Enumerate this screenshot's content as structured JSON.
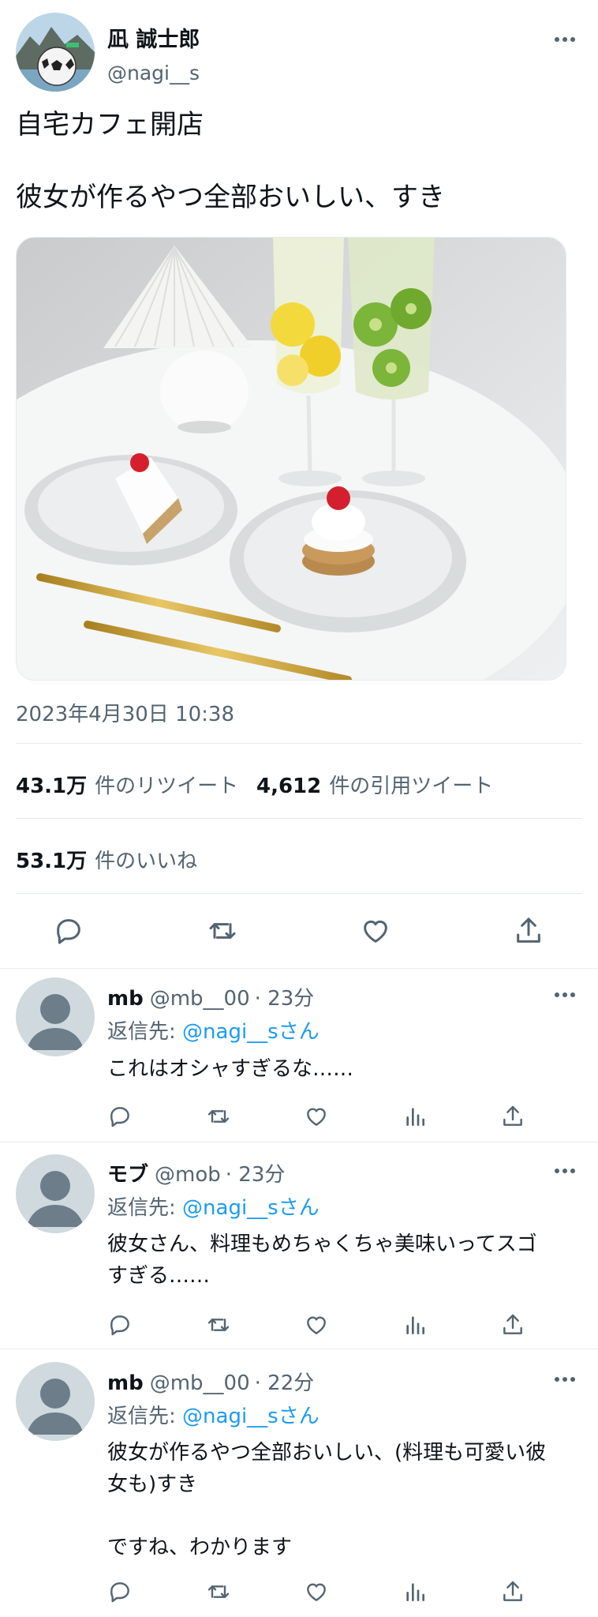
{
  "author": {
    "name": "凪 誠士郎",
    "handle": "@nagi__s"
  },
  "tweet": {
    "line1": "自宅カフェ開店",
    "line2": "彼女が作るやつ全部おいしい、すき",
    "timestamp": "2023年4月30日 10:38"
  },
  "stats": {
    "retweets": "43.1万",
    "retweets_label": "件のリツイート",
    "quotes": "4,612",
    "quotes_label": "件の引用ツイート",
    "likes": "53.1万",
    "likes_label": "件のいいね"
  },
  "icons": {
    "reply": "reply-icon",
    "retweet": "retweet-icon",
    "like": "heart-icon",
    "views": "analytics-icon",
    "share": "share-icon",
    "more": "more-icon"
  },
  "replies": [
    {
      "name": "mb",
      "handle": "@mb__00",
      "time": "· 23分",
      "reply_to_prefix": "返信先: ",
      "reply_to": "@nagi__sさん",
      "text": "これはオシャすぎるな……"
    },
    {
      "name": "モブ",
      "handle": "@mob",
      "time": "· 23分",
      "reply_to_prefix": "返信先: ",
      "reply_to": "@nagi__sさん",
      "text": "彼女さん、料理もめちゃくちゃ美味いってスゴ\nすぎる……"
    },
    {
      "name": "mb",
      "handle": "@mb__00",
      "time": "· 22分",
      "reply_to_prefix": "返信先: ",
      "reply_to": "@nagi__sさん",
      "text": "彼女が作るやつ全部おいしい、(料理も可愛い彼\n女も)すき\n\nですね、わかります"
    }
  ],
  "colors": {
    "link": "#1d9bf0",
    "muted": "#536471",
    "divider": "#e6ebee"
  }
}
